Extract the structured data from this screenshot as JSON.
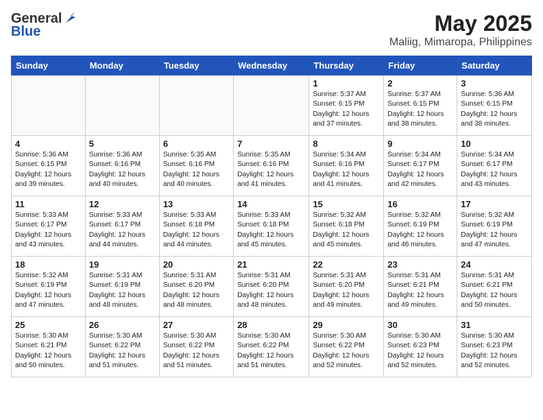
{
  "header": {
    "logo_line1": "General",
    "logo_line2": "Blue",
    "title": "May 2025",
    "subtitle": "Maliig, Mimaropa, Philippines"
  },
  "weekdays": [
    "Sunday",
    "Monday",
    "Tuesday",
    "Wednesday",
    "Thursday",
    "Friday",
    "Saturday"
  ],
  "weeks": [
    [
      {
        "day": "",
        "info": ""
      },
      {
        "day": "",
        "info": ""
      },
      {
        "day": "",
        "info": ""
      },
      {
        "day": "",
        "info": ""
      },
      {
        "day": "1",
        "info": "Sunrise: 5:37 AM\nSunset: 6:15 PM\nDaylight: 12 hours\nand 37 minutes."
      },
      {
        "day": "2",
        "info": "Sunrise: 5:37 AM\nSunset: 6:15 PM\nDaylight: 12 hours\nand 38 minutes."
      },
      {
        "day": "3",
        "info": "Sunrise: 5:36 AM\nSunset: 6:15 PM\nDaylight: 12 hours\nand 38 minutes."
      }
    ],
    [
      {
        "day": "4",
        "info": "Sunrise: 5:36 AM\nSunset: 6:15 PM\nDaylight: 12 hours\nand 39 minutes."
      },
      {
        "day": "5",
        "info": "Sunrise: 5:36 AM\nSunset: 6:16 PM\nDaylight: 12 hours\nand 40 minutes."
      },
      {
        "day": "6",
        "info": "Sunrise: 5:35 AM\nSunset: 6:16 PM\nDaylight: 12 hours\nand 40 minutes."
      },
      {
        "day": "7",
        "info": "Sunrise: 5:35 AM\nSunset: 6:16 PM\nDaylight: 12 hours\nand 41 minutes."
      },
      {
        "day": "8",
        "info": "Sunrise: 5:34 AM\nSunset: 6:16 PM\nDaylight: 12 hours\nand 41 minutes."
      },
      {
        "day": "9",
        "info": "Sunrise: 5:34 AM\nSunset: 6:17 PM\nDaylight: 12 hours\nand 42 minutes."
      },
      {
        "day": "10",
        "info": "Sunrise: 5:34 AM\nSunset: 6:17 PM\nDaylight: 12 hours\nand 43 minutes."
      }
    ],
    [
      {
        "day": "11",
        "info": "Sunrise: 5:33 AM\nSunset: 6:17 PM\nDaylight: 12 hours\nand 43 minutes."
      },
      {
        "day": "12",
        "info": "Sunrise: 5:33 AM\nSunset: 6:17 PM\nDaylight: 12 hours\nand 44 minutes."
      },
      {
        "day": "13",
        "info": "Sunrise: 5:33 AM\nSunset: 6:18 PM\nDaylight: 12 hours\nand 44 minutes."
      },
      {
        "day": "14",
        "info": "Sunrise: 5:33 AM\nSunset: 6:18 PM\nDaylight: 12 hours\nand 45 minutes."
      },
      {
        "day": "15",
        "info": "Sunrise: 5:32 AM\nSunset: 6:18 PM\nDaylight: 12 hours\nand 45 minutes."
      },
      {
        "day": "16",
        "info": "Sunrise: 5:32 AM\nSunset: 6:19 PM\nDaylight: 12 hours\nand 46 minutes."
      },
      {
        "day": "17",
        "info": "Sunrise: 5:32 AM\nSunset: 6:19 PM\nDaylight: 12 hours\nand 47 minutes."
      }
    ],
    [
      {
        "day": "18",
        "info": "Sunrise: 5:32 AM\nSunset: 6:19 PM\nDaylight: 12 hours\nand 47 minutes."
      },
      {
        "day": "19",
        "info": "Sunrise: 5:31 AM\nSunset: 6:19 PM\nDaylight: 12 hours\nand 48 minutes."
      },
      {
        "day": "20",
        "info": "Sunrise: 5:31 AM\nSunset: 6:20 PM\nDaylight: 12 hours\nand 48 minutes."
      },
      {
        "day": "21",
        "info": "Sunrise: 5:31 AM\nSunset: 6:20 PM\nDaylight: 12 hours\nand 48 minutes."
      },
      {
        "day": "22",
        "info": "Sunrise: 5:31 AM\nSunset: 6:20 PM\nDaylight: 12 hours\nand 49 minutes."
      },
      {
        "day": "23",
        "info": "Sunrise: 5:31 AM\nSunset: 6:21 PM\nDaylight: 12 hours\nand 49 minutes."
      },
      {
        "day": "24",
        "info": "Sunrise: 5:31 AM\nSunset: 6:21 PM\nDaylight: 12 hours\nand 50 minutes."
      }
    ],
    [
      {
        "day": "25",
        "info": "Sunrise: 5:30 AM\nSunset: 6:21 PM\nDaylight: 12 hours\nand 50 minutes."
      },
      {
        "day": "26",
        "info": "Sunrise: 5:30 AM\nSunset: 6:22 PM\nDaylight: 12 hours\nand 51 minutes."
      },
      {
        "day": "27",
        "info": "Sunrise: 5:30 AM\nSunset: 6:22 PM\nDaylight: 12 hours\nand 51 minutes."
      },
      {
        "day": "28",
        "info": "Sunrise: 5:30 AM\nSunset: 6:22 PM\nDaylight: 12 hours\nand 51 minutes."
      },
      {
        "day": "29",
        "info": "Sunrise: 5:30 AM\nSunset: 6:22 PM\nDaylight: 12 hours\nand 52 minutes."
      },
      {
        "day": "30",
        "info": "Sunrise: 5:30 AM\nSunset: 6:23 PM\nDaylight: 12 hours\nand 52 minutes."
      },
      {
        "day": "31",
        "info": "Sunrise: 5:30 AM\nSunset: 6:23 PM\nDaylight: 12 hours\nand 52 minutes."
      }
    ]
  ]
}
